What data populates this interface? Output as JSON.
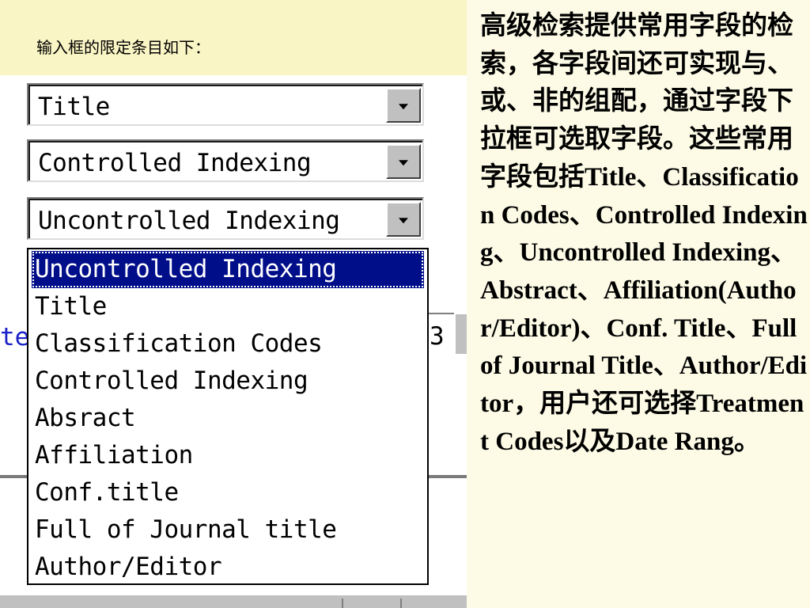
{
  "caption": "输入框的限定条目如下：",
  "combos": [
    {
      "value": "Title"
    },
    {
      "value": "Controlled Indexing"
    },
    {
      "value": "Uncontrolled Indexing"
    }
  ],
  "background": {
    "row_text": "te",
    "field_fragment": "3"
  },
  "dropdown": {
    "options": [
      "Uncontrolled Indexing",
      "Title",
      "Classification Codes",
      "Controlled Indexing",
      "Absract",
      "Affiliation",
      "Conf.title",
      "Full of Journal title",
      "Author/Editor"
    ],
    "selected_index": 0
  },
  "description": "高级检索提供常用字段的检索，各字段间还可实现与、或、非的组配，通过字段下拉框可选取字段。这些常用字段包括Title、Classification Codes、Controlled Indexing、Uncontrolled Indexing、Abstract、Affiliation(Author/Editor)、Conf. Title、Full of Journal Title、Author/Editor，用户还可选择Treatment Codes以及Date Rang。",
  "colors": {
    "caption_background": "#faf5c4",
    "page_background": "#fdfbe6",
    "selection": "#000e8a",
    "link_text": "#1a22c8"
  }
}
